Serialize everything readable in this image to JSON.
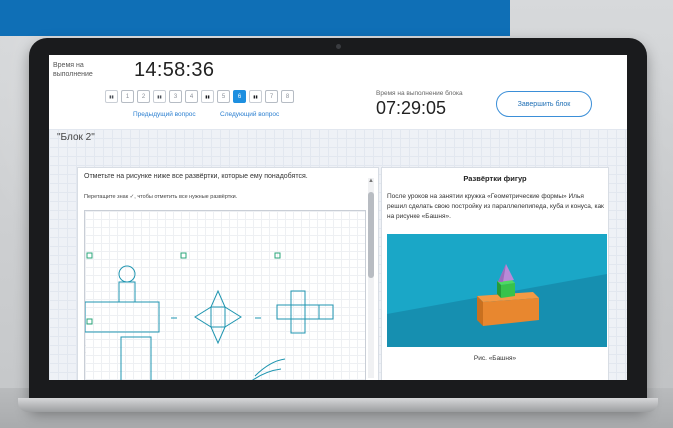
{
  "header": {
    "timer_label": "Время на выполнение",
    "timer_value": "14:58:36",
    "prev_link": "Предыдущий вопрос",
    "next_link": "Следующий вопрос",
    "block_time_label": "Время на выполнение блока",
    "block_time_value": "07:29:05",
    "finish_button": "Завершить блок"
  },
  "questions": [
    {
      "label": "",
      "type": "book",
      "state": "default"
    },
    {
      "label": "1",
      "type": "num",
      "state": "default"
    },
    {
      "label": "2",
      "type": "num",
      "state": "default"
    },
    {
      "label": "",
      "type": "book",
      "state": "default"
    },
    {
      "label": "3",
      "type": "num",
      "state": "default"
    },
    {
      "label": "4",
      "type": "num",
      "state": "default"
    },
    {
      "label": "",
      "type": "book",
      "state": "dark"
    },
    {
      "label": "5",
      "type": "num",
      "state": "default"
    },
    {
      "label": "6",
      "type": "num",
      "state": "active"
    },
    {
      "label": "",
      "type": "book",
      "state": "dark"
    },
    {
      "label": "7",
      "type": "num",
      "state": "default"
    },
    {
      "label": "8",
      "type": "num",
      "state": "default"
    }
  ],
  "block": {
    "title": "\"Блок 2\""
  },
  "task": {
    "question": "Отметьте на рисунке ниже все развёртки, которые ему понадобятся.",
    "hint": "Перетащите знак ✓, чтобы отметить все нужные развёртки."
  },
  "info": {
    "title": "Развёртки фигур",
    "text": "После уроков на занятии кружка «Геометрические формы» Илья решил сделать свою постройку из параллелепипеда, куба и конуса, как на рисунке «Башня».",
    "caption": "Рис. «Башня»"
  },
  "colors": {
    "accent": "#1d8fe0",
    "banner": "#0f6fb6",
    "image_bg": "#1aa7c7",
    "box": "#e8872f",
    "cube": "#38c24b",
    "cone": "#b98ad8"
  }
}
